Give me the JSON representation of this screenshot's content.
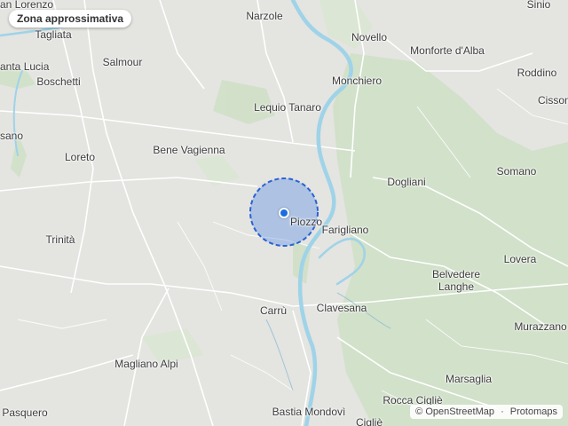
{
  "map": {
    "badge_label": "Zona approssimativa",
    "attribution": {
      "copyright": "©",
      "osm": "OpenStreetMap",
      "separator": "·",
      "protomaps": "Protomaps"
    },
    "places": {
      "lorenzo": "an Lorenzo",
      "narzole": "Narzole",
      "sinio": "Sinio",
      "tagliata": "Tagliata",
      "novello": "Novello",
      "monforte": "Monforte d'Alba",
      "salmour": "Salmour",
      "santa_lucia": "anta Lucia",
      "roddino": "Roddino",
      "boschetti": "Boschetti",
      "monchiero": "Monchiero",
      "cissone": "Cisson",
      "lequio": "Lequio Tanaro",
      "sano": "sano",
      "bene_vagienna": "Bene Vagienna",
      "loreto": "Loreto",
      "somano": "Somano",
      "dogliani": "Dogliani",
      "piozzo": "Piozzo",
      "farigliano": "Farigliano",
      "trinita": "Trinità",
      "lovera": "Lovera",
      "belvedere_langhe": "Belvedere\nLanghe",
      "carru": "Carrù",
      "clavesana": "Clavesana",
      "murazzano": "Murazzano",
      "magliano_alpi": "Magliano Alpi",
      "marsaglia": "Marsaglia",
      "rocca_cigliè": "Rocca Cigliè",
      "pasquero": "Pasquero",
      "bastia_mondovi": "Bastia Mondovì",
      "ciglie": "Cigliè"
    },
    "colors": {
      "land": "#e4e4e1",
      "wooded": "#c9ddc0",
      "water": "#9fd3e8",
      "accuracy_fill": "#4a86e8",
      "accuracy_stroke": "#2a62d2",
      "location_dot": "#1a6ee0"
    },
    "icons": {
      "location": "blue-dot"
    }
  }
}
